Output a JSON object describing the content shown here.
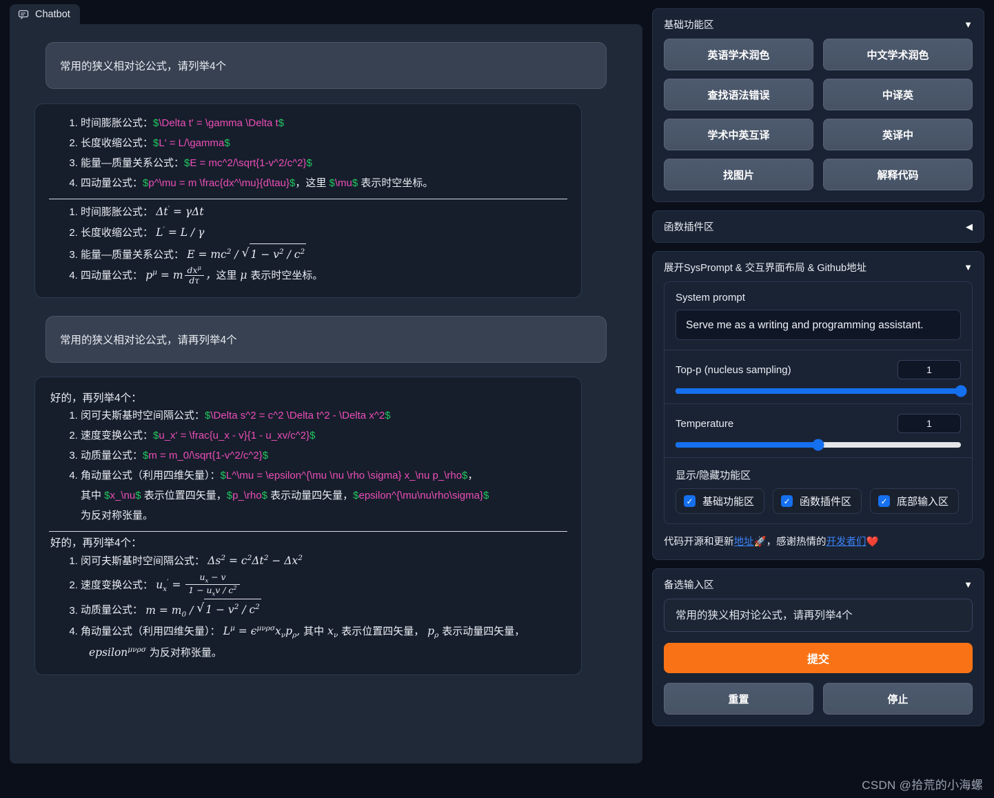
{
  "app": {
    "tab_label": "Chatbot",
    "tab_icon": "chat-bubble-icon",
    "watermark": "CSDN @拾荒的小海螺"
  },
  "conversation": [
    {
      "role": "user",
      "text": "常用的狭义相对论公式，请列举4个"
    },
    {
      "role": "bot",
      "raw_items": [
        {
          "label": "时间膨胀公式：",
          "tex": "$\\Delta t' = \\gamma \\Delta t$",
          "tail": ""
        },
        {
          "label": "长度收缩公式：",
          "tex": "$L' = L/\\gamma$",
          "tail": ""
        },
        {
          "label": "能量—质量关系公式：",
          "tex": "$E = mc^2/\\sqrt{1-v^2/c^2}$",
          "tail": ""
        },
        {
          "label": "四动量公式：",
          "tex": "$p^\\mu = m \\frac{dx^\\mu}{d\\tau}$",
          "tail": "，这里 $\\mu$ 表示时空坐标。"
        }
      ],
      "rendered_items": [
        {
          "label": "时间膨胀公式：",
          "math": "Δt′ = γΔt"
        },
        {
          "label": "长度收缩公式：",
          "math": "L′ = L / γ"
        },
        {
          "label": "能量—质量关系公式：",
          "math": "E = mc² / √(1 − v²/c²)"
        },
        {
          "label": "四动量公式：",
          "math": "p^μ = m dx^μ/dτ，这里 μ 表示时空坐标。"
        }
      ]
    },
    {
      "role": "user",
      "text": "常用的狭义相对论公式，请再列举4个"
    },
    {
      "role": "bot",
      "lead": "好的，再列举4个：",
      "raw_items": [
        {
          "label": "闵可夫斯基时空间隔公式：",
          "tex": "$\\Delta s^2 = c^2 \\Delta t^2 - \\Delta x^2$",
          "tail": ""
        },
        {
          "label": "速度变换公式：",
          "tex": "$u_x' = \\frac{u_x - v}{1 - u_xv/c^2}$",
          "tail": ""
        },
        {
          "label": "动质量公式：",
          "tex": "$m = m_0/\\sqrt{1-v^2/c^2}$",
          "tail": ""
        },
        {
          "label": "角动量公式（利用四维矢量）：",
          "tex": "$L^\\mu = \\epsilon^{\\mu \\nu \\rho \\sigma} x_\\nu p_\\rho$",
          "tail": "，其中 $x_\\nu$ 表示位置四矢量，$p_\\rho$ 表示动量四矢量，$epsilon^{\\mu\\nu\\rho\\sigma}$ 为反对称张量。"
        }
      ],
      "rendered_lead": "好的，再列举4个：",
      "rendered_items": [
        {
          "label": "闵可夫斯基时空间隔公式：",
          "math": "Δs² = c²Δt² − Δx²"
        },
        {
          "label": "速度变换公式：",
          "math": "u_x′ = (u_x − v)/(1 − u_x v / c²)"
        },
        {
          "label": "动质量公式：",
          "math": "m = m₀ / √(1 − v²/c²)"
        },
        {
          "label": "角动量公式（利用四维矢量）：",
          "math": "L^μ = ε^{μνρσ} x_ν p_ρ，其中 x_ν 表示位置四矢量，p_ρ 表示动量四矢量，epsilon^{μνρσ} 为反对称张量。"
        }
      ]
    }
  ],
  "basic_panel": {
    "title": "基础功能区",
    "caret": "▼",
    "buttons": [
      "英语学术润色",
      "中文学术润色",
      "查找语法错误",
      "中译英",
      "学术中英互译",
      "英译中",
      "找图片",
      "解释代码"
    ]
  },
  "plugin_panel": {
    "title": "函数插件区",
    "caret": "◀"
  },
  "sys_panel": {
    "title": "展开SysPrompt & 交互界面布局 & Github地址",
    "caret": "▼",
    "system_prompt_label": "System prompt",
    "system_prompt_value": "Serve me as a writing and programming assistant.",
    "topp_label": "Top-p (nucleus sampling)",
    "topp_value": "1",
    "topp_percent": 100,
    "temp_label": "Temperature",
    "temp_value": "1",
    "temp_percent": 50,
    "toggles_label": "显示/隐藏功能区",
    "toggles": [
      {
        "label": "基础功能区",
        "checked": true
      },
      {
        "label": "函数插件区",
        "checked": true
      },
      {
        "label": "底部输入区",
        "checked": true
      }
    ],
    "credit_pre": "代码开源和更新",
    "credit_link1": "地址",
    "credit_emoji1": "🚀",
    "credit_mid": "，感谢热情的",
    "credit_link2": "开发者们",
    "credit_emoji2": "❤️"
  },
  "input_panel": {
    "title": "备选输入区",
    "caret": "▼",
    "input_value": "常用的狭义相对论公式，请再列举4个",
    "submit_label": "提交",
    "reset_label": "重置",
    "stop_label": "停止",
    "accent_color": "#f97316"
  }
}
